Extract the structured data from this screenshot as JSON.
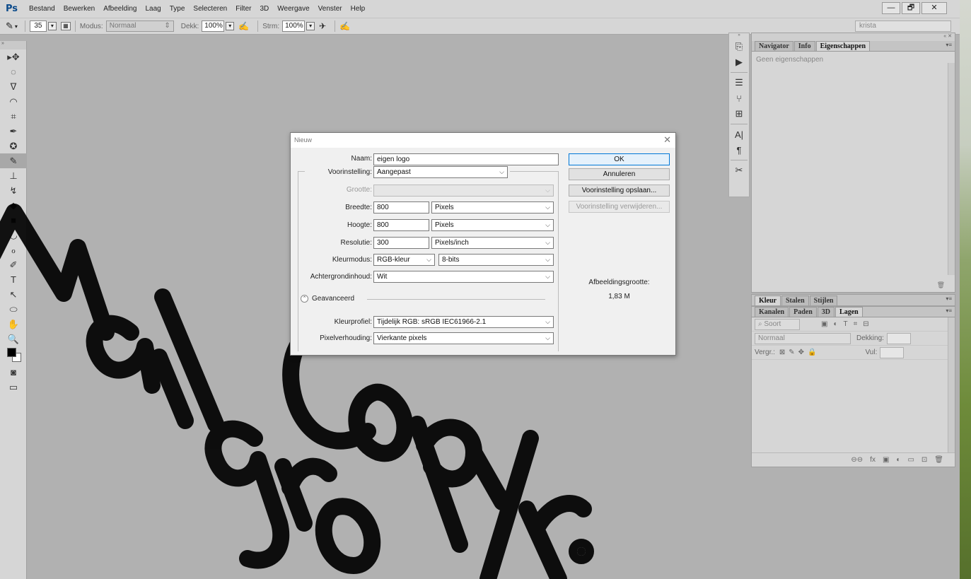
{
  "app": {
    "logo": "Ps"
  },
  "menubar": {
    "items": [
      "Bestand",
      "Bewerken",
      "Afbeelding",
      "Laag",
      "Type",
      "Selecteren",
      "Filter",
      "3D",
      "Weergave",
      "Venster",
      "Help"
    ],
    "window_controls": {
      "minimize": "—",
      "restore": "🗗",
      "close": "✕"
    }
  },
  "options_bar": {
    "brush_size": "35",
    "mode_label": "Modus:",
    "mode_value": "Normaal",
    "opacity_label": "Dekk:",
    "opacity_value": "100%",
    "flow_label": "Strm:",
    "flow_value": "100%",
    "workspace": "krista"
  },
  "tools": {
    "icons": [
      "move-tool-icon",
      "marquee-tool-icon",
      "lasso-tool-icon",
      "quick-select-tool-icon",
      "crop-tool-icon",
      "eyedropper-tool-icon",
      "healing-brush-tool-icon",
      "brush-tool-icon",
      "clone-stamp-tool-icon",
      "history-brush-tool-icon",
      "eraser-tool-icon",
      "gradient-tool-icon",
      "blur-tool-icon",
      "dodge-tool-icon",
      "pen-tool-icon",
      "type-tool-icon",
      "path-select-tool-icon",
      "shape-tool-icon",
      "hand-tool-icon",
      "zoom-tool-icon"
    ],
    "glyphs": [
      "▸✥",
      "◌",
      "ᐁ",
      "◠",
      "⌗",
      "✒",
      "✪",
      "✎",
      "⊥",
      "↯",
      "◆",
      "■",
      "◡",
      "ℴ",
      "✐",
      "T",
      "↖",
      "⬭",
      "✋",
      "🔍"
    ],
    "active_index": 7,
    "colors": {
      "foreground": "#000000",
      "background": "#ffffff"
    }
  },
  "dock": {
    "icons": [
      "history-icon",
      "play-actions-icon",
      "adjustments-icon",
      "brush-presets-icon",
      "clone-source-icon",
      "character-icon",
      "paragraph-icon",
      "tool-presets-icon"
    ],
    "glyphs": [
      "⎘",
      "▶",
      "☰",
      "⑂",
      "⊞",
      "A|",
      "¶",
      "✂"
    ]
  },
  "properties_panel": {
    "tabs": [
      "Navigator",
      "Info",
      "Eigenschappen"
    ],
    "active_tab": "Eigenschappen",
    "empty_text": "Geen eigenschappen"
  },
  "color_panel": {
    "tabs": [
      "Kleur",
      "Stalen",
      "Stijlen"
    ],
    "active_tab": "Kleur"
  },
  "layers_panel": {
    "tabs": [
      "Kanalen",
      "Paden",
      "3D",
      "Lagen"
    ],
    "active_tab": "Lagen",
    "filter_label": "Soort",
    "blend_mode": "Normaal",
    "opacity_label": "Dekking:",
    "lock_label": "Vergr.:",
    "fill_label": "Vul:"
  },
  "dialog": {
    "title": "Nieuw",
    "close": "✕",
    "name_label": "Naam:",
    "name_value": "eigen logo",
    "preset_label": "Voorinstelling:",
    "preset_value": "Aangepast",
    "size_label": "Grootte:",
    "size_value": "",
    "width_label": "Breedte:",
    "width_value": "800",
    "width_unit": "Pixels",
    "height_label": "Hoogte:",
    "height_value": "800",
    "height_unit": "Pixels",
    "resolution_label": "Resolutie:",
    "resolution_value": "300",
    "resolution_unit": "Pixels/inch",
    "colormode_label": "Kleurmodus:",
    "colormode_value": "RGB-kleur",
    "bitdepth_value": "8-bits",
    "background_label": "Achtergrondinhoud:",
    "background_value": "Wit",
    "advanced_label": "Geavanceerd",
    "profile_label": "Kleurprofiel:",
    "profile_value": "Tijdelijk RGB:  sRGB IEC61966-2.1",
    "pixelaspect_label": "Pixelverhouding:",
    "pixelaspect_value": "Vierkante pixels",
    "ok": "OK",
    "cancel": "Annuleren",
    "save_preset": "Voorinstelling opslaan...",
    "delete_preset": "Voorinstelling verwijderen...",
    "image_size_label": "Afbeeldingsgrootte:",
    "image_size_value": "1,83 M"
  }
}
